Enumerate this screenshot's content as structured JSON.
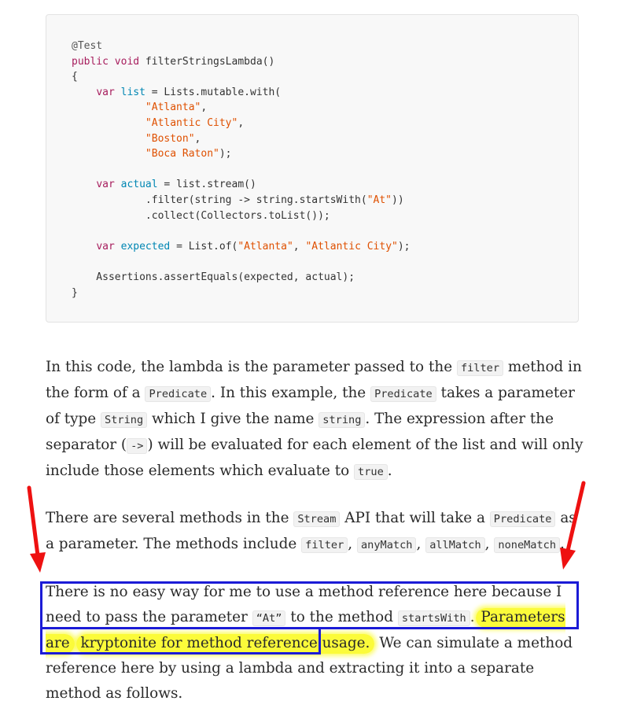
{
  "code": {
    "lines": [
      [
        [
          "an",
          "@Test"
        ]
      ],
      [
        [
          "kw",
          "public"
        ],
        [
          "",
          " "
        ],
        [
          "kw",
          "void"
        ],
        [
          "",
          " filterStringsLambda()"
        ]
      ],
      [
        [
          "",
          "{"
        ]
      ],
      [
        [
          "",
          "    "
        ],
        [
          "kw",
          "var"
        ],
        [
          "",
          " "
        ],
        [
          "ty",
          "list"
        ],
        [
          "",
          " = Lists.mutable.with("
        ]
      ],
      [
        [
          "",
          "            "
        ],
        [
          "st",
          "\"Atlanta\""
        ],
        [
          "",
          ","
        ]
      ],
      [
        [
          "",
          "            "
        ],
        [
          "st",
          "\"Atlantic City\""
        ],
        [
          "",
          ","
        ]
      ],
      [
        [
          "",
          "            "
        ],
        [
          "st",
          "\"Boston\""
        ],
        [
          "",
          ","
        ]
      ],
      [
        [
          "",
          "            "
        ],
        [
          "st",
          "\"Boca Raton\""
        ],
        [
          "",
          ");"
        ]
      ],
      [
        [
          "",
          ""
        ]
      ],
      [
        [
          "",
          "    "
        ],
        [
          "kw",
          "var"
        ],
        [
          "",
          " "
        ],
        [
          "ty",
          "actual"
        ],
        [
          "",
          " = list.stream()"
        ]
      ],
      [
        [
          "",
          "            .filter(string -> string.startsWith("
        ],
        [
          "st",
          "\"At\""
        ],
        [
          "",
          "))"
        ]
      ],
      [
        [
          "",
          "            .collect(Collectors.toList());"
        ]
      ],
      [
        [
          "",
          ""
        ]
      ],
      [
        [
          "",
          "    "
        ],
        [
          "kw",
          "var"
        ],
        [
          "",
          " "
        ],
        [
          "ty",
          "expected"
        ],
        [
          "",
          " = List.of("
        ],
        [
          "st",
          "\"Atlanta\""
        ],
        [
          "",
          ", "
        ],
        [
          "st",
          "\"Atlantic City\""
        ],
        [
          "",
          ");"
        ]
      ],
      [
        [
          "",
          ""
        ]
      ],
      [
        [
          "",
          "    Assertions.assertEquals(expected, actual);"
        ]
      ],
      [
        [
          "",
          "}"
        ]
      ]
    ]
  },
  "para1": {
    "t1": "In this code, the lambda is the parameter passed to the",
    "c1": "filter",
    "t2": "method in the form of a",
    "c2": "Predicate",
    "t3": ". In this example, the",
    "c3": "Predicate",
    "t4": "takes a parameter of type",
    "c4": "String",
    "t5": "which I give the name",
    "c5": "string",
    "t6": ". The expression after the separator (",
    "c6": "->",
    "t7": ") will be evaluated for each element of the list and will only include those elements which evaluate to",
    "c7": "true",
    "t8": "."
  },
  "para2": {
    "t1": "There are several methods in the",
    "c1": "Stream",
    "t2": "API that will take a",
    "c2": "Predicate",
    "t3": "as a parameter. The methods include",
    "c3": "filter",
    "s1": ",",
    "c4": "anyMatch",
    "s2": ",",
    "c5": "allMatch",
    "s3": ",",
    "c6": "noneMatch",
    "t4": "."
  },
  "para3": {
    "t1": "There is no easy way for me to use a method reference here because I need to pass the parameter",
    "c1": "“At”",
    "t2": "to the method",
    "c2": "startsWith",
    "t3": ".",
    "h1": "Parameters are",
    "h2": "kryptonite for method reference usage.",
    "t4": "We can simulate a method reference here by using a lambda and extracting it into a separate method as follows."
  },
  "colors": {
    "arrow": "#ee1111",
    "highlight": "#fbfb3a",
    "box": "#1b1bd6",
    "code_bg": "#f8f8f8"
  }
}
